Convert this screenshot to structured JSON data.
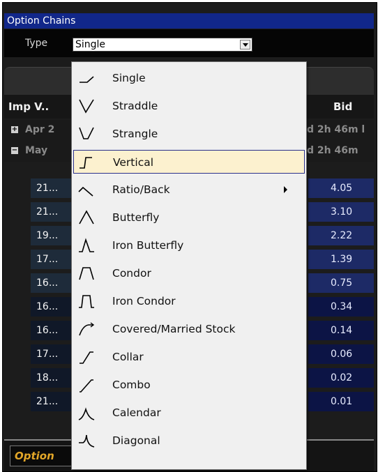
{
  "window": {
    "title": "Option Chains"
  },
  "type_row": {
    "label": "Type",
    "selected": "Single"
  },
  "table": {
    "headers": {
      "imp_vol": "Imp V..",
      "bid": "Bid"
    },
    "groups": [
      {
        "label": "Apr 2",
        "expiry": "d 2h 46m l",
        "expanded": false
      },
      {
        "label": "May",
        "expiry": "d 2h 46m",
        "expanded": true
      }
    ],
    "rows": [
      {
        "iv": "21...",
        "bid": "4.05"
      },
      {
        "iv": "21...",
        "bid": "3.10"
      },
      {
        "iv": "19...",
        "bid": "2.22"
      },
      {
        "iv": "17...",
        "bid": "1.39"
      },
      {
        "iv": "16...",
        "bid": "0.75"
      },
      {
        "iv": "16...",
        "bid": "0.34"
      },
      {
        "iv": "16...",
        "bid": "0.14"
      },
      {
        "iv": "17...",
        "bid": "0.06"
      },
      {
        "iv": "18...",
        "bid": "0.02"
      },
      {
        "iv": "21...",
        "bid": "0.01"
      }
    ]
  },
  "bottom_tab": {
    "label": "Option"
  },
  "dropdown": {
    "items": [
      {
        "label": "Single",
        "icon": "single-icon"
      },
      {
        "label": "Straddle",
        "icon": "straddle-icon"
      },
      {
        "label": "Strangle",
        "icon": "strangle-icon"
      },
      {
        "label": "Vertical",
        "icon": "vertical-icon",
        "selected": true
      },
      {
        "label": "Ratio/Back",
        "icon": "ratio-back-icon",
        "submenu": true
      },
      {
        "label": "Butterfly",
        "icon": "butterfly-icon"
      },
      {
        "label": "Iron Butterfly",
        "icon": "iron-butterfly-icon"
      },
      {
        "label": "Condor",
        "icon": "condor-icon"
      },
      {
        "label": "Iron Condor",
        "icon": "iron-condor-icon"
      },
      {
        "label": "Covered/Married Stock",
        "icon": "covered-married-stock-icon"
      },
      {
        "label": "Collar",
        "icon": "collar-icon"
      },
      {
        "label": "Combo",
        "icon": "combo-icon"
      },
      {
        "label": "Calendar",
        "icon": "calendar-spread-icon"
      },
      {
        "label": "Diagonal",
        "icon": "diagonal-icon"
      }
    ]
  },
  "colors": {
    "title_bar": "#11278a",
    "selected_item_bg": "#fcf1cf",
    "selected_item_border": "#2a2f8a",
    "bid_column": "#1d2a66",
    "bottom_tab_text": "#e2a628"
  }
}
